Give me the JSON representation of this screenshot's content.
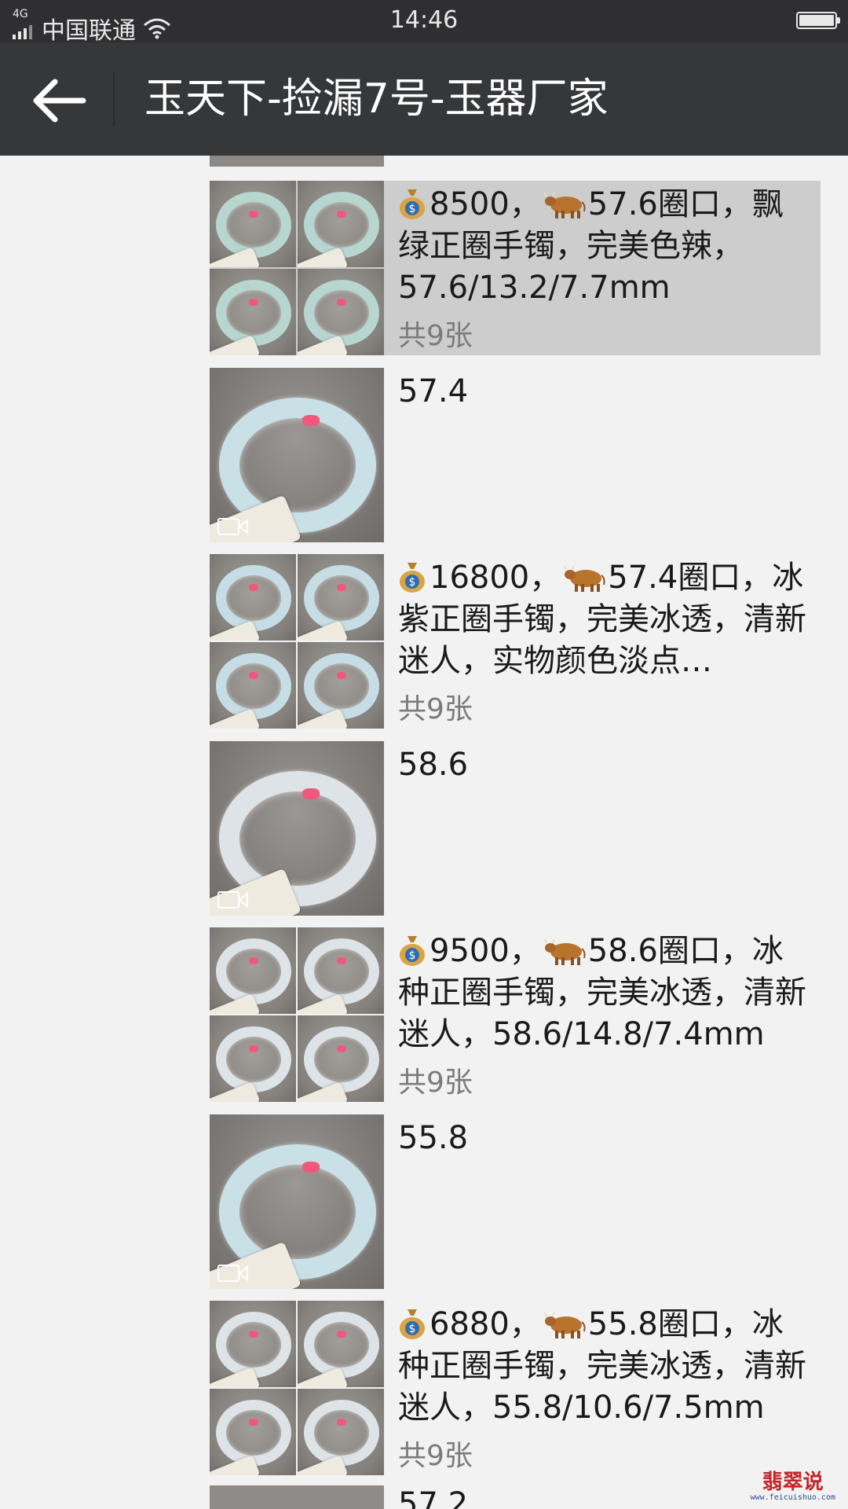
{
  "status_bar": {
    "network": "4G",
    "carrier": "中国联通",
    "time": "14:46"
  },
  "header": {
    "title": "玉天下-捡漏7号-玉器厂家"
  },
  "posts": [
    {
      "type": "grid",
      "price": "8500，",
      "text": "57.6圈口，飘绿正圈手镯，完美色辣，57.6/13.2/7.7mm",
      "count": "共9张",
      "highlighted": true
    },
    {
      "type": "video",
      "text": "57.4"
    },
    {
      "type": "grid",
      "price": "16800，",
      "text": "57.4圈口，冰紫正圈手镯，完美冰透，清新迷人，实物颜色淡点…",
      "count": "共9张"
    },
    {
      "type": "video",
      "text": "58.6"
    },
    {
      "type": "grid",
      "price": "9500，",
      "text": "58.6圈口，冰种正圈手镯，完美冰透，清新迷人，58.6/14.8/7.4mm",
      "count": "共9张"
    },
    {
      "type": "video",
      "text": "55.8"
    },
    {
      "type": "grid",
      "price": "6880，",
      "text": "55.8圈口，冰种正圈手镯，完美冰透，清新迷人，55.8/10.6/7.5mm",
      "count": "共9张"
    }
  ],
  "partial_next_post": {
    "text": "57.2"
  },
  "watermark": {
    "title": "翡翠说",
    "url": "www.feicuishuo.com"
  },
  "icons": [
    "back-arrow-icon",
    "signal-icon",
    "wifi-icon",
    "battery-icon",
    "video-icon",
    "money-bag-emoji",
    "ox-emoji"
  ],
  "colors": {
    "header_bg": "#363739",
    "status_bg": "#2f2f31",
    "feed_bg": "#f2f2f2",
    "highlight_bg": "#cdcdcd"
  }
}
